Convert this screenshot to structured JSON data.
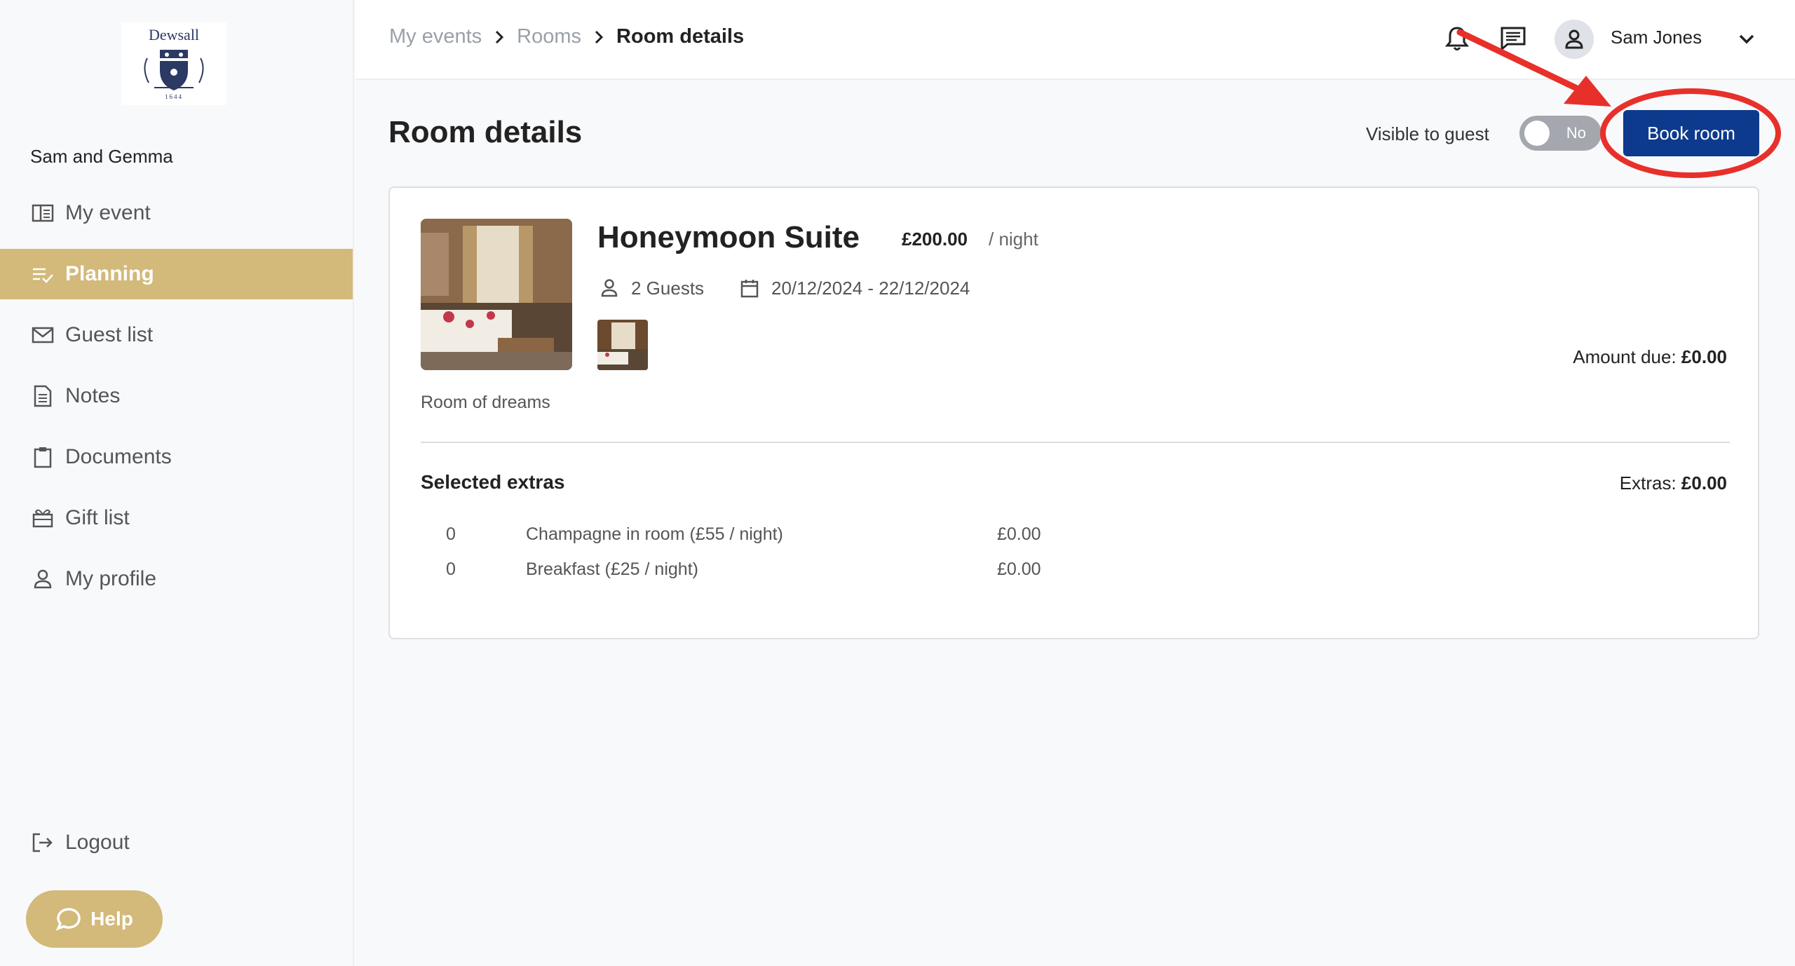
{
  "sidebar": {
    "logo_text": "Dewsall",
    "logo_year": "1644",
    "event_name": "Sam and Gemma",
    "items": [
      {
        "label": "My event",
        "icon": "book-open-icon"
      },
      {
        "label": "Planning",
        "icon": "checklist-icon",
        "active": true
      },
      {
        "label": "Guest list",
        "icon": "envelope-icon"
      },
      {
        "label": "Notes",
        "icon": "document-icon"
      },
      {
        "label": "Documents",
        "icon": "clipboard-icon"
      },
      {
        "label": "Gift list",
        "icon": "gift-icon"
      },
      {
        "label": "My profile",
        "icon": "user-icon"
      }
    ],
    "logout_label": "Logout",
    "help_label": "Help"
  },
  "header": {
    "breadcrumbs": [
      "My events",
      "Rooms",
      "Room details"
    ],
    "user_name": "Sam Jones"
  },
  "main": {
    "title": "Room details",
    "visible_to_guest_label": "Visible to guest",
    "toggle_value": "No",
    "book_button": "Book room"
  },
  "room": {
    "name": "Honeymoon Suite",
    "price": "£200.00",
    "per_night": "/ night",
    "guests": "2 Guests",
    "dates": "20/12/2024 - 22/12/2024",
    "amount_due_label": "Amount due:",
    "amount_due": "£0.00",
    "description": "Room of dreams"
  },
  "extras": {
    "title": "Selected extras",
    "total_label": "Extras:",
    "total": "£0.00",
    "rows": [
      {
        "qty": "0",
        "name": "Champagne in room (£55 / night)",
        "price": "£0.00"
      },
      {
        "qty": "0",
        "name": "Breakfast (£25 / night)",
        "price": "£0.00"
      }
    ]
  },
  "colors": {
    "accent_gold": "#d3b97a",
    "primary_blue": "#0d3a8c",
    "annotation_red": "#e8302a"
  }
}
